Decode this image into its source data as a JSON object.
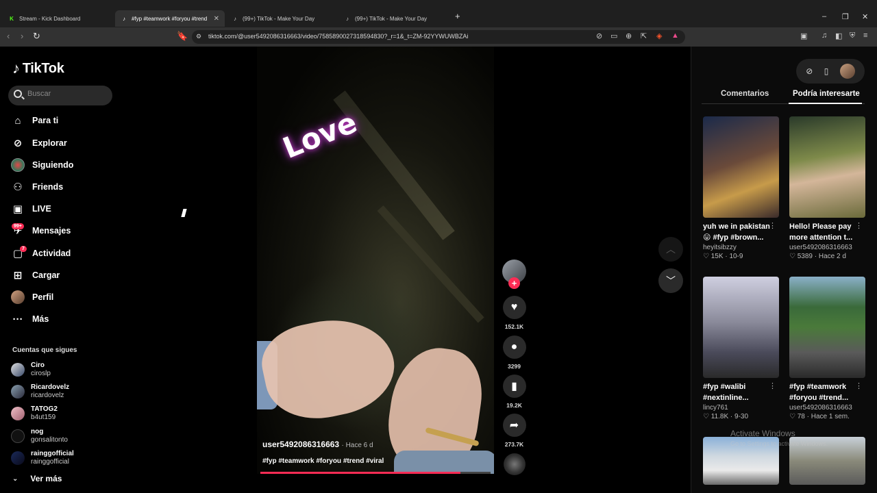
{
  "browser": {
    "tabs": [
      {
        "label": "Stream - Kick Dashboard",
        "favicon": "kick-icon",
        "active": false
      },
      {
        "label": "#fyp #teamwork #foryou #trend",
        "favicon": "tiktok-icon",
        "active": true
      },
      {
        "label": "(99+) TikTok - Make Your Day",
        "favicon": "tiktok-icon",
        "active": false
      },
      {
        "label": "(99+) TikTok - Make Your Day",
        "favicon": "tiktok-icon",
        "active": false
      }
    ],
    "url": "tiktok.com/@user5492086316663/video/7585890027318594830?_r=1&_t=ZM-92YYWUWBZAi"
  },
  "sidebar": {
    "logo_text": "TikTok",
    "search_placeholder": "Buscar",
    "nav": [
      {
        "label": "Para ti",
        "icon": "home-icon"
      },
      {
        "label": "Explorar",
        "icon": "compass-icon"
      },
      {
        "label": "Siguiendo",
        "icon": "following-avatar-icon"
      },
      {
        "label": "Friends",
        "icon": "friends-icon"
      },
      {
        "label": "LIVE",
        "icon": "live-icon"
      },
      {
        "label": "Mensajes",
        "icon": "messages-icon",
        "badge": "99+"
      },
      {
        "label": "Actividad",
        "icon": "activity-icon",
        "badge": "7"
      },
      {
        "label": "Cargar",
        "icon": "upload-icon"
      },
      {
        "label": "Perfil",
        "icon": "profile-avatar-icon"
      },
      {
        "label": "Más",
        "icon": "more-dots-icon"
      }
    ],
    "following_title": "Cuentas que sigues",
    "accounts": [
      {
        "name": "Ciro",
        "handle": "ciroslp"
      },
      {
        "name": "Ricardovelz",
        "handle": "ricardovelz"
      },
      {
        "name": "TATOG2",
        "handle": "b4ut159"
      },
      {
        "name": "nog",
        "handle": "gonsalitonto"
      },
      {
        "name": "rainggofficial",
        "handle": "rainggofficial"
      }
    ],
    "see_more": "Ver más"
  },
  "video": {
    "overlay_text": "Love",
    "author": "user5492086316663",
    "time_ago": "Hace 6 d",
    "tags": "#fyp #teamwork #foryou #trend #viral",
    "progress": 0.87
  },
  "actions": {
    "likes": "152.1K",
    "comments": "3299",
    "saves": "19.2K",
    "shares": "273.7K"
  },
  "right_panel": {
    "tab_comments": "Comentarios",
    "tab_suggested": "Podría interesarte",
    "cards": [
      {
        "caption1": "yuh we in pakistan",
        "caption2": "😛 #fyp #brown...",
        "author": "heyitsibzzy",
        "likes": "15K",
        "date": "10-9",
        "thumb": "linear-gradient(160deg,#1b2a4a 0%,#6a4a3a 45%,#c79b4a 70%,#3a2a2a 100%)"
      },
      {
        "caption1": "Hello! Please pay",
        "caption2": "more attention t...",
        "author": "user5492086316663",
        "likes": "5389",
        "date": "Hace 2 d",
        "thumb": "linear-gradient(170deg,#2a3a2a 0%,#7e8a4a 40%,#d4b69a 60%,#6a6a3a 100%)"
      },
      {
        "caption1": "#fyp #walibi",
        "caption2": "#nextinline...",
        "author": "lincy761",
        "likes": "11.8K",
        "date": "9-30",
        "thumb": "linear-gradient(180deg,#cfcfe0 0%,#8a8a9a 45%,#4a4a5a 75%,#2a2a2a 100%)"
      },
      {
        "caption1": "#fyp #teamwork",
        "caption2": "#foryou #trend...",
        "author": "user5492086316663",
        "likes": "78",
        "date": "Hace 1 sem.",
        "thumb": "linear-gradient(180deg,#8ab0c8 0%,#3a6a3a 30%,#4a7a3a 50%,#5a5a5a 75%,#2a2a2a 100%)"
      },
      {
        "caption1": "",
        "caption2": "",
        "author": "",
        "likes": "",
        "date": "",
        "thumb": "linear-gradient(180deg,#8ab0d8 0%,#cfd8e0 40%,#eaeaea 70%,#6a6a6a 100%)"
      },
      {
        "caption1": "",
        "caption2": "",
        "author": "",
        "likes": "",
        "date": "",
        "thumb": "linear-gradient(180deg,#c8d0d8 0%,#8a8a7a 50%,#5a5a5a 100%)"
      }
    ],
    "watermark_title": "Activate Windows",
    "watermark_sub": "Go to Settings to activate Windows."
  },
  "colors": {
    "accent": "#fe2c55",
    "bg": "#000000",
    "panel": "#0b0b0b"
  }
}
